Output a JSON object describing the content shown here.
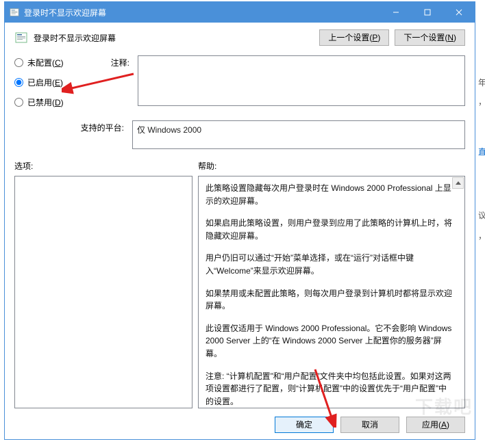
{
  "titlebar": {
    "title": "登录时不显示欢迎屏幕"
  },
  "header": {
    "title": "登录时不显示欢迎屏幕",
    "prev_btn": "上一个设置(",
    "prev_key": "P",
    "next_btn": "下一个设置(",
    "next_key": "N",
    "btn_close": ")"
  },
  "radios": {
    "unconfigured": "未配置(",
    "unconfigured_key": "C",
    "enabled": "已启用(",
    "enabled_key": "E",
    "disabled": "已禁用(",
    "disabled_key": "D",
    "paren_close": ")",
    "selected": "enabled"
  },
  "labels": {
    "comment": "注释:",
    "platform": "支持的平台:",
    "options": "选项:",
    "help": "帮助:"
  },
  "platform_text": "仅 Windows 2000",
  "help_paragraphs": [
    "此策略设置隐藏每次用户登录时在 Windows 2000 Professional 上显示的欢迎屏幕。",
    "如果启用此策略设置，则用户登录到应用了此策略的计算机上时，将隐藏欢迎屏幕。",
    "用户仍旧可以通过“开始”菜单选择，或在“运行”对话框中键入“Welcome”来显示欢迎屏幕。",
    "如果禁用或未配置此策略，则每次用户登录到计算机时都将显示欢迎屏幕。",
    "此设置仅适用于 Windows 2000 Professional。它不会影响 Windows 2000 Server 上的“在 Windows 2000 Server 上配置你的服务器”屏幕。",
    "注意: “计算机配置”和“用户配置”文件夹中均包括此设置。如果对这两项设置都进行了配置，则“计算机配置”中的设置优先于“用户配置”中的设置。"
  ],
  "footer": {
    "ok": "确定",
    "cancel": "取消",
    "apply_pre": "应用(",
    "apply_key": "A",
    "apply_post": ")"
  },
  "watermark": "下载吧"
}
